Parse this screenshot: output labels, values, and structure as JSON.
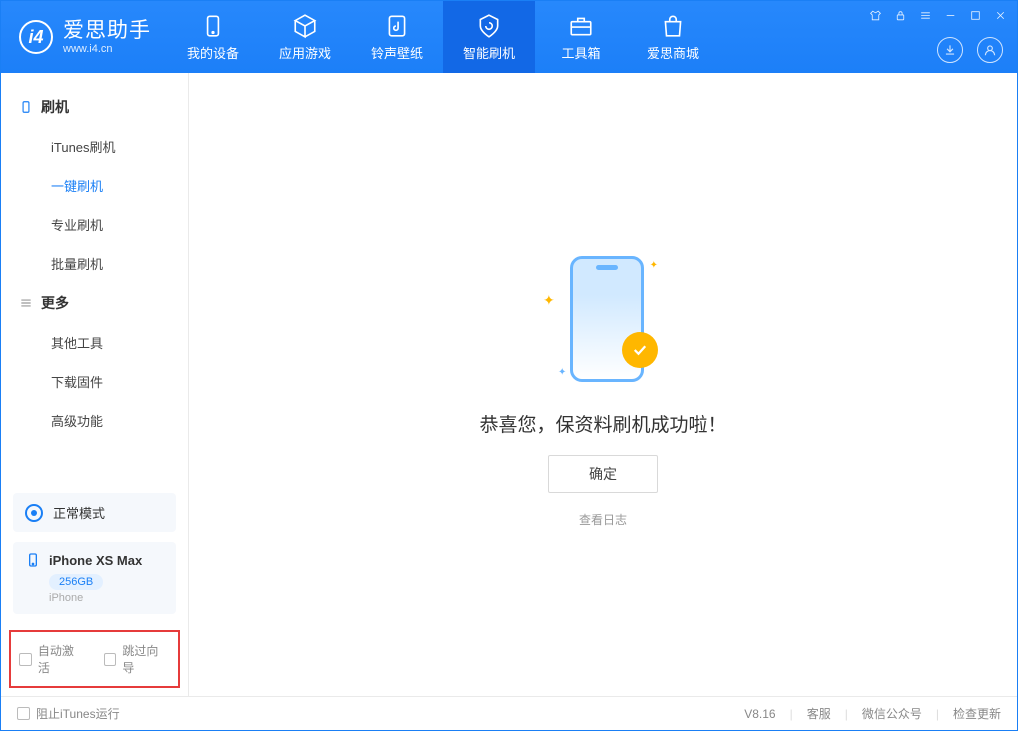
{
  "app": {
    "name_cn": "爱思助手",
    "name_en": "www.i4.cn"
  },
  "tabs": {
    "device": "我的设备",
    "apps": "应用游戏",
    "ring": "铃声壁纸",
    "flash": "智能刷机",
    "tools": "工具箱",
    "store": "爱思商城"
  },
  "sidebar": {
    "group1": "刷机",
    "items1": {
      "itunes": "iTunes刷机",
      "onekey": "一键刷机",
      "pro": "专业刷机",
      "batch": "批量刷机"
    },
    "group2": "更多",
    "items2": {
      "other": "其他工具",
      "fw": "下载固件",
      "adv": "高级功能"
    }
  },
  "mode": {
    "label": "正常模式"
  },
  "device": {
    "name": "iPhone XS Max",
    "storage": "256GB",
    "type": "iPhone"
  },
  "options": {
    "auto_activate": "自动激活",
    "skip_guide": "跳过向导"
  },
  "main": {
    "message": "恭喜您，保资料刷机成功啦！",
    "ok": "确定",
    "viewlog": "查看日志"
  },
  "status": {
    "itunes_block": "阻止iTunes运行",
    "version": "V8.16",
    "service": "客服",
    "wechat": "微信公众号",
    "update": "检查更新"
  }
}
